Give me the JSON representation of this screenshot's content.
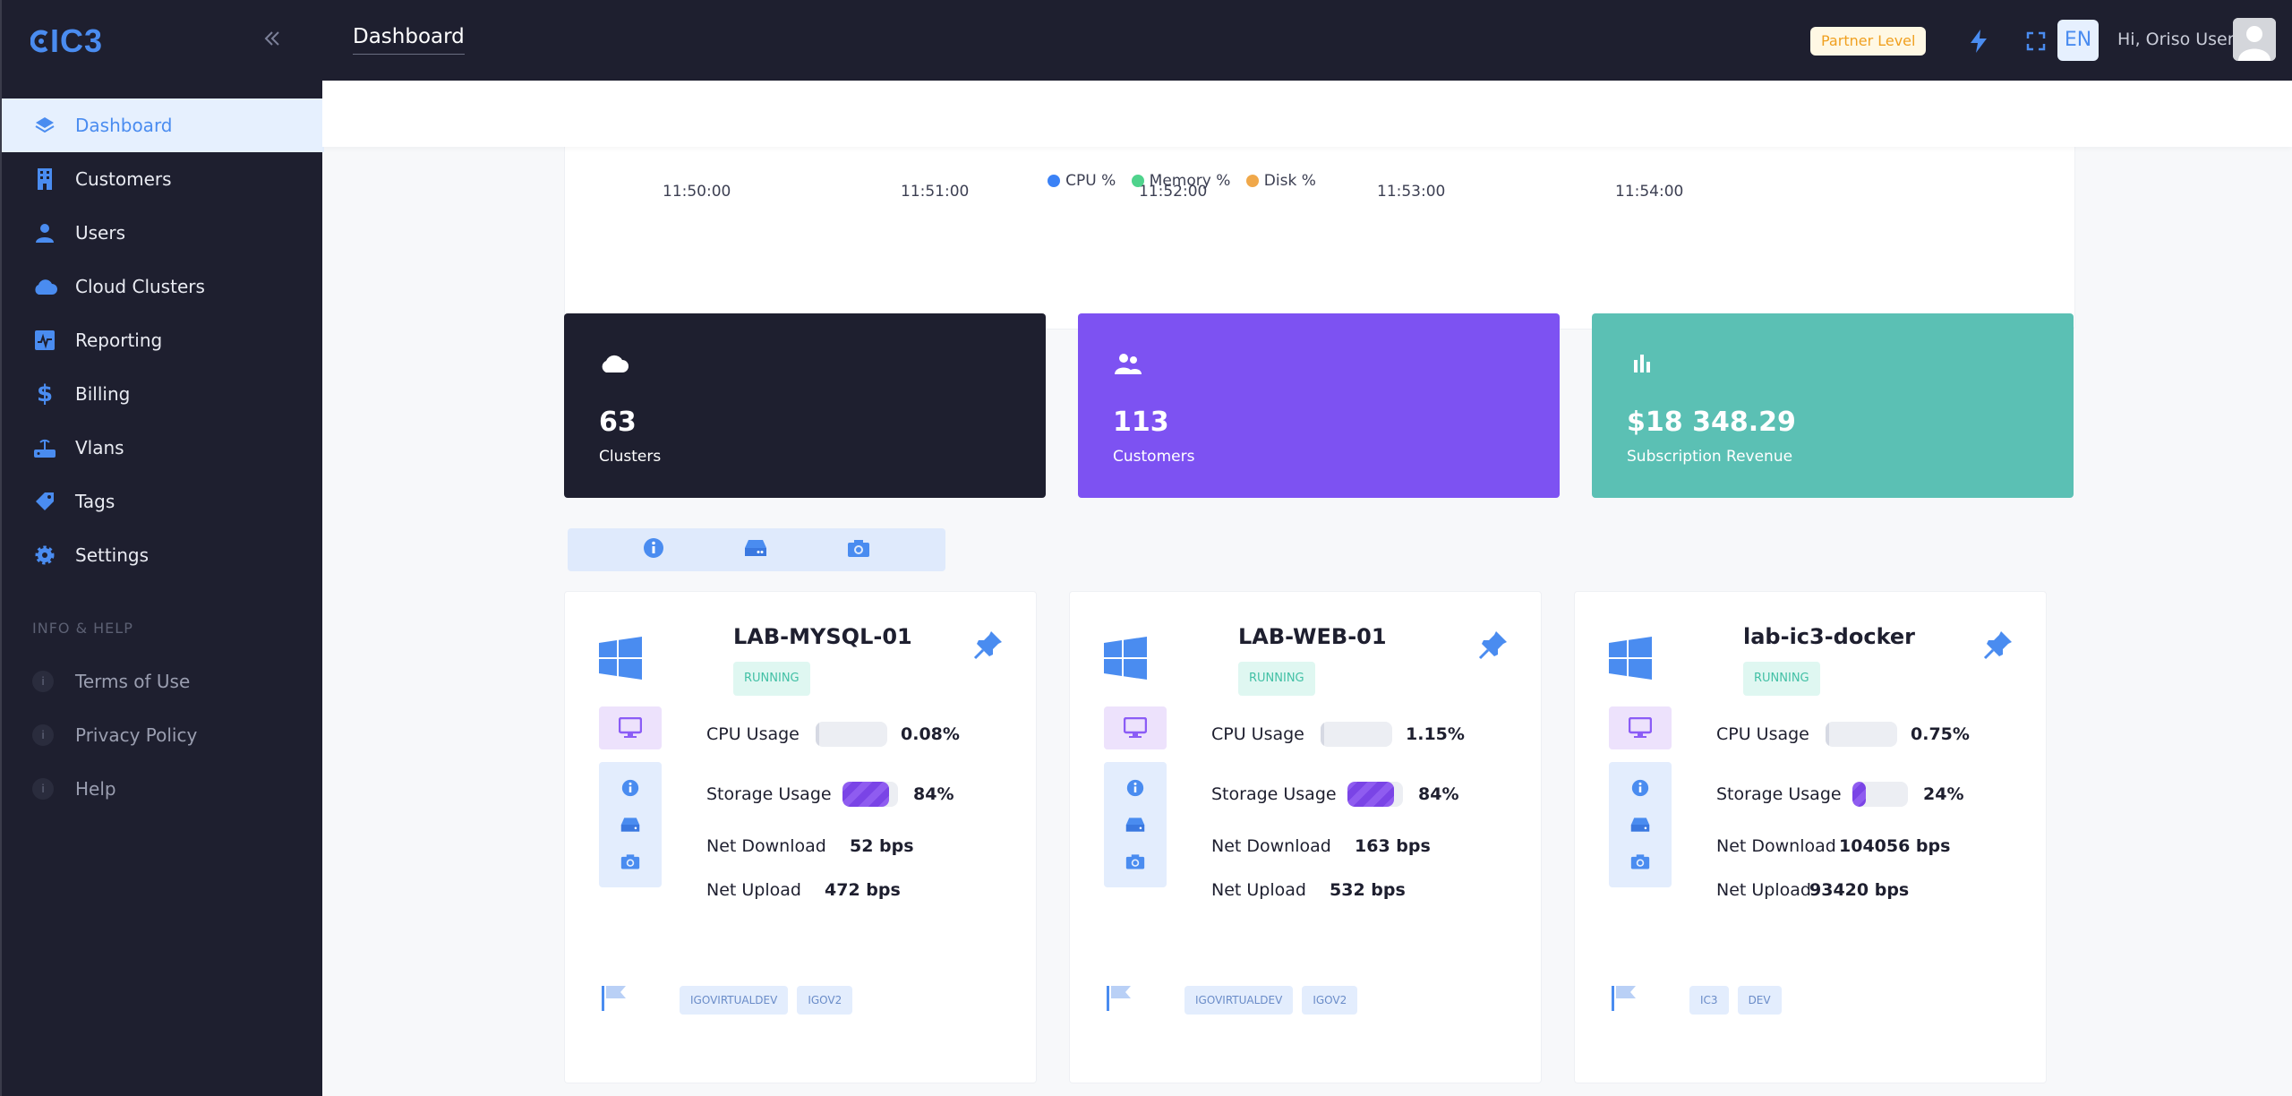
{
  "app": {
    "logo": "IC3"
  },
  "sidebar": {
    "items": [
      {
        "label": "Dashboard",
        "icon": "layers-icon"
      },
      {
        "label": "Customers",
        "icon": "building-icon"
      },
      {
        "label": "Users",
        "icon": "user-icon"
      },
      {
        "label": "Cloud Clusters",
        "icon": "cloud-icon"
      },
      {
        "label": "Reporting",
        "icon": "chart-icon"
      },
      {
        "label": "Billing",
        "icon": "dollar-icon"
      },
      {
        "label": "Vlans",
        "icon": "router-icon"
      },
      {
        "label": "Tags",
        "icon": "tag-icon"
      },
      {
        "label": "Settings",
        "icon": "gear-icon"
      }
    ],
    "section_title": "INFO & HELP",
    "help_items": [
      {
        "label": "Terms of Use"
      },
      {
        "label": "Privacy Policy"
      },
      {
        "label": "Help"
      }
    ]
  },
  "header": {
    "title": "Dashboard",
    "partner_level": "Partner Level",
    "language": "EN",
    "greeting": "Hi, Oriso User"
  },
  "chart": {
    "ticks": [
      "11:50:00",
      "11:51:00",
      "11:52:00",
      "11:53:00",
      "11:54:00"
    ],
    "legend": [
      {
        "name": "CPU %",
        "color": "#3b82f6"
      },
      {
        "name": "Memory %",
        "color": "#4fd38c"
      },
      {
        "name": "Disk %",
        "color": "#f0a84a"
      }
    ]
  },
  "stats": [
    {
      "value": "63",
      "label": "Clusters",
      "color": "#1e1f2f",
      "icon": "cloud-icon"
    },
    {
      "value": "113",
      "label": "Customers",
      "color": "#7d52f2",
      "icon": "users-icon"
    },
    {
      "value": "$18 348.29",
      "label": "Subscription Revenue",
      "color": "#5bc0b4",
      "icon": "bar-chart-icon"
    }
  ],
  "vms": [
    {
      "name": "LAB-MYSQL-01",
      "status": "RUNNING",
      "cpu_label": "CPU Usage",
      "cpu": "0.08%",
      "cpu_pct": 0.0008,
      "storage_label": "Storage Usage",
      "storage": "84%",
      "storage_pct": 0.84,
      "down_label": "Net Download",
      "down": "52 bps",
      "up_label": "Net Upload",
      "up": "472 bps",
      "tags": [
        "IGOVIRTUALDEV",
        "IGOV2"
      ]
    },
    {
      "name": "LAB-WEB-01",
      "status": "RUNNING",
      "cpu_label": "CPU Usage",
      "cpu": "1.15%",
      "cpu_pct": 0.0115,
      "storage_label": "Storage Usage",
      "storage": "84%",
      "storage_pct": 0.84,
      "down_label": "Net Download",
      "down": "163 bps",
      "up_label": "Net Upload",
      "up": "532 bps",
      "tags": [
        "IGOVIRTUALDEV",
        "IGOV2"
      ]
    },
    {
      "name": "lab-ic3-docker",
      "status": "RUNNING",
      "cpu_label": "CPU Usage",
      "cpu": "0.75%",
      "cpu_pct": 0.0075,
      "storage_label": "Storage Usage",
      "storage": "24%",
      "storage_pct": 0.24,
      "down_label": "Net Download",
      "down": "104056 bps",
      "up_label": "Net Upload",
      "up": "93420 bps",
      "tags": [
        "IC3",
        "DEV"
      ]
    }
  ]
}
